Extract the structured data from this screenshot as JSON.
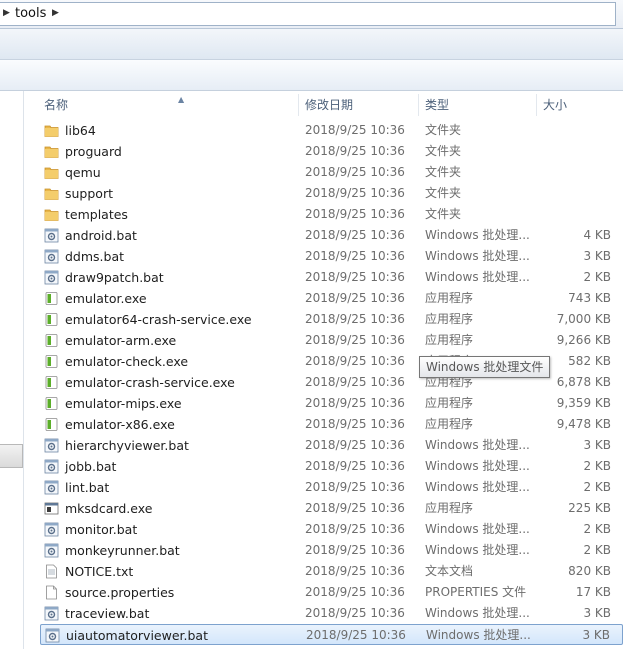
{
  "address": {
    "path_segment": "tools"
  },
  "columns": {
    "name": "名称",
    "date": "修改日期",
    "type": "类型",
    "size": "大小"
  },
  "tooltip": {
    "text": "Windows 批处理文件"
  },
  "files": [
    {
      "name": "lib64",
      "date": "2018/9/25 10:36",
      "type": "文件夹",
      "size": "",
      "icon": "folder-icon"
    },
    {
      "name": "proguard",
      "date": "2018/9/25 10:36",
      "type": "文件夹",
      "size": "",
      "icon": "folder-icon"
    },
    {
      "name": "qemu",
      "date": "2018/9/25 10:36",
      "type": "文件夹",
      "size": "",
      "icon": "folder-icon"
    },
    {
      "name": "support",
      "date": "2018/9/25 10:36",
      "type": "文件夹",
      "size": "",
      "icon": "folder-icon"
    },
    {
      "name": "templates",
      "date": "2018/9/25 10:36",
      "type": "文件夹",
      "size": "",
      "icon": "folder-icon"
    },
    {
      "name": "android.bat",
      "date": "2018/9/25 10:36",
      "type": "Windows 批处理...",
      "size": "4 KB",
      "icon": "batch-file-icon"
    },
    {
      "name": "ddms.bat",
      "date": "2018/9/25 10:36",
      "type": "Windows 批处理...",
      "size": "3 KB",
      "icon": "batch-file-icon"
    },
    {
      "name": "draw9patch.bat",
      "date": "2018/9/25 10:36",
      "type": "Windows 批处理...",
      "size": "2 KB",
      "icon": "batch-file-icon"
    },
    {
      "name": "emulator.exe",
      "date": "2018/9/25 10:36",
      "type": "应用程序",
      "size": "743 KB",
      "icon": "android-exe-icon"
    },
    {
      "name": "emulator64-crash-service.exe",
      "date": "2018/9/25 10:36",
      "type": "应用程序",
      "size": "7,000 KB",
      "icon": "android-exe-icon"
    },
    {
      "name": "emulator-arm.exe",
      "date": "2018/9/25 10:36",
      "type": "应用程序",
      "size": "9,266 KB",
      "icon": "android-exe-icon"
    },
    {
      "name": "emulator-check.exe",
      "date": "2018/9/25 10:36",
      "type": "应用程序",
      "size": "582 KB",
      "icon": "android-exe-icon"
    },
    {
      "name": "emulator-crash-service.exe",
      "date": "2018/9/25 10:36",
      "type": "应用程序",
      "size": "6,878 KB",
      "icon": "android-exe-icon"
    },
    {
      "name": "emulator-mips.exe",
      "date": "2018/9/25 10:36",
      "type": "应用程序",
      "size": "9,359 KB",
      "icon": "android-exe-icon"
    },
    {
      "name": "emulator-x86.exe",
      "date": "2018/9/25 10:36",
      "type": "应用程序",
      "size": "9,478 KB",
      "icon": "android-exe-icon"
    },
    {
      "name": "hierarchyviewer.bat",
      "date": "2018/9/25 10:36",
      "type": "Windows 批处理...",
      "size": "3 KB",
      "icon": "batch-file-icon"
    },
    {
      "name": "jobb.bat",
      "date": "2018/9/25 10:36",
      "type": "Windows 批处理...",
      "size": "2 KB",
      "icon": "batch-file-icon"
    },
    {
      "name": "lint.bat",
      "date": "2018/9/25 10:36",
      "type": "Windows 批处理...",
      "size": "2 KB",
      "icon": "batch-file-icon"
    },
    {
      "name": "mksdcard.exe",
      "date": "2018/9/25 10:36",
      "type": "应用程序",
      "size": "225 KB",
      "icon": "generic-exe-icon"
    },
    {
      "name": "monitor.bat",
      "date": "2018/9/25 10:36",
      "type": "Windows 批处理...",
      "size": "2 KB",
      "icon": "batch-file-icon"
    },
    {
      "name": "monkeyrunner.bat",
      "date": "2018/9/25 10:36",
      "type": "Windows 批处理...",
      "size": "2 KB",
      "icon": "batch-file-icon"
    },
    {
      "name": "NOTICE.txt",
      "date": "2018/9/25 10:36",
      "type": "文本文档",
      "size": "820 KB",
      "icon": "text-file-icon"
    },
    {
      "name": "source.properties",
      "date": "2018/9/25 10:36",
      "type": "PROPERTIES 文件",
      "size": "17 KB",
      "icon": "blank-file-icon"
    },
    {
      "name": "traceview.bat",
      "date": "2018/9/25 10:36",
      "type": "Windows 批处理...",
      "size": "3 KB",
      "icon": "batch-file-icon"
    },
    {
      "name": "uiautomatorviewer.bat",
      "date": "2018/9/25 10:36",
      "type": "Windows 批处理...",
      "size": "3 KB",
      "icon": "batch-file-icon",
      "selected": true
    }
  ]
}
